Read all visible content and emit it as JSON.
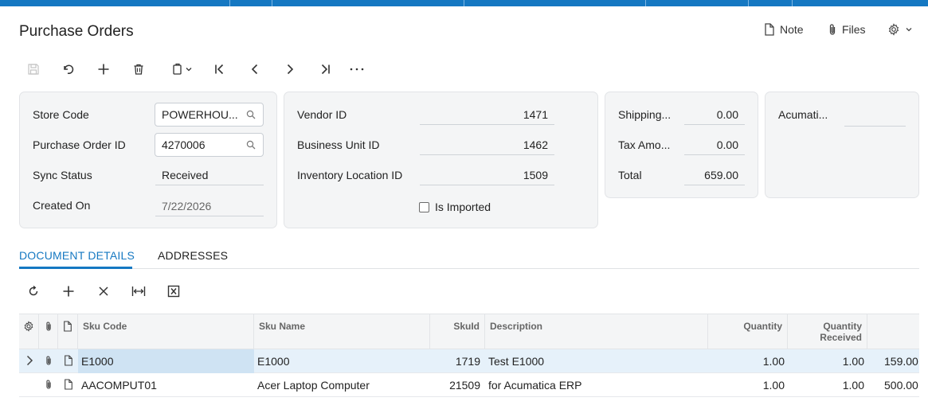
{
  "header": {
    "title": "Purchase Orders",
    "note_label": "Note",
    "files_label": "Files"
  },
  "toolbar": [
    "save-icon",
    "undo-icon",
    "add-icon",
    "delete-icon",
    "copy-paste-icon",
    "first-record-icon",
    "previous-record-icon",
    "next-record-icon",
    "last-record-icon",
    "more-icon"
  ],
  "summary": {
    "store_code_label": "Store Code",
    "store_code": "POWERHOU...",
    "po_id_label": "Purchase Order ID",
    "po_id": "4270006",
    "sync_status_label": "Sync Status",
    "sync_status": "Received",
    "created_on_label": "Created On",
    "created_on": "7/22/2026",
    "vendor_id_label": "Vendor ID",
    "vendor_id": "1471",
    "business_unit_id_label": "Business Unit ID",
    "business_unit_id": "1462",
    "inventory_location_id_label": "Inventory Location ID",
    "inventory_location_id": "1509",
    "is_imported_label": "Is Imported",
    "shipping_label": "Shipping...",
    "shipping": "0.00",
    "tax_amount_label": "Tax Amo...",
    "tax_amount": "0.00",
    "total_label": "Total",
    "total": "659.00",
    "acumatica_label": "Acumati...",
    "acumatica": ""
  },
  "tabs": {
    "document_details": "DOCUMENT DETAILS",
    "addresses": "ADDRESSES"
  },
  "grid_toolbar": [
    "refresh-icon",
    "add-row-icon",
    "delete-row-icon",
    "fit-columns-icon",
    "export-excel-icon"
  ],
  "grid": {
    "columns": {
      "sku_code": "Sku Code",
      "sku_name": "Sku Name",
      "sku_id": "SkuId",
      "description": "Description",
      "quantity": "Quantity",
      "quantity_received_1": "Quantity",
      "quantity_received_2": "Received"
    },
    "rows": [
      {
        "sku_code": "E1000",
        "sku_name": "E1000",
        "sku_id": "1719",
        "description": "Test E1000",
        "quantity": "1.00",
        "quantity_received": "1.00",
        "price": "159.00"
      },
      {
        "sku_code": "AACOMPUT01",
        "sku_name": "Acer Laptop Computer",
        "sku_id": "21509",
        "description": "for Acumatica ERP",
        "quantity": "1.00",
        "quantity_received": "1.00",
        "price": "500.00"
      }
    ]
  },
  "colors": {
    "accent": "#1578c2",
    "panel": "#f4f5f6",
    "selected_row": "#e6f1fa"
  }
}
